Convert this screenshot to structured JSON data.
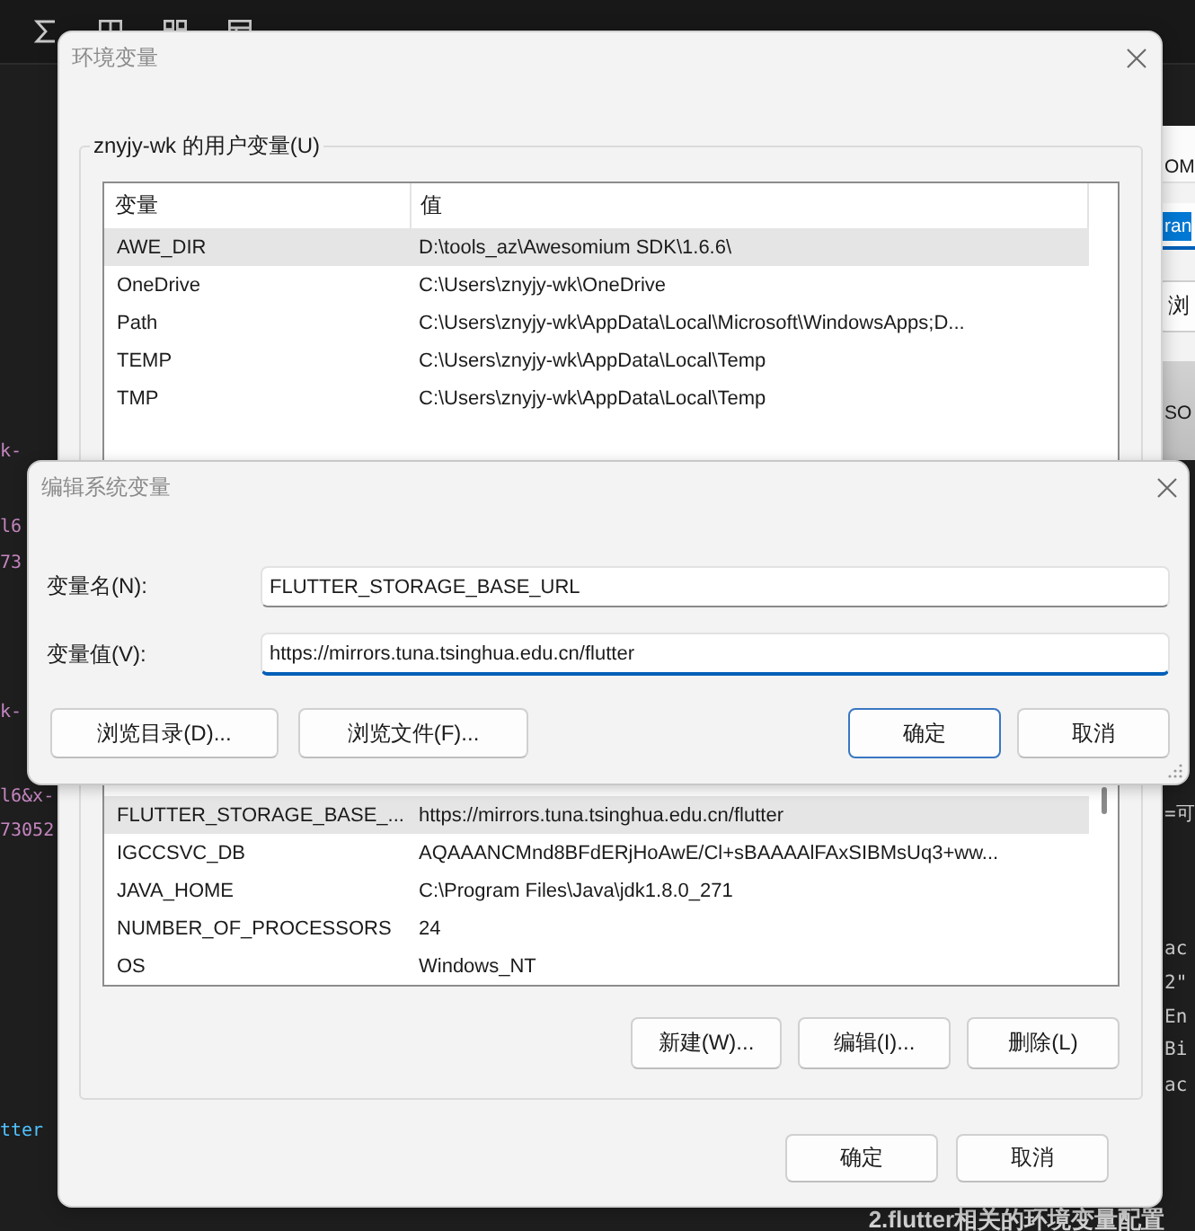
{
  "editor": {
    "left_fragments": [
      {
        "text": "k-",
        "kind": "string"
      },
      {
        "text": "l6",
        "kind": "string"
      },
      {
        "text": "73",
        "kind": "string"
      },
      {
        "text": "k-",
        "kind": "string"
      },
      {
        "text": "l6&x-",
        "kind": "string"
      },
      {
        "text": "73052",
        "kind": "string"
      },
      {
        "text": "tter",
        "kind": "name"
      }
    ],
    "right_fragments": [
      "=可",
      "ac",
      "2\"",
      "En",
      "Bi",
      "ac"
    ]
  },
  "background_window": {
    "header_text": "OM",
    "selected_text": "ran",
    "button": "浏",
    "panel_text": "SO"
  },
  "env_dialog": {
    "title": "环境变量",
    "user_group": {
      "label": "znyjy-wk 的用户变量(U)",
      "columns": [
        "变量",
        "值"
      ],
      "rows": [
        {
          "name": "AWE_DIR",
          "value": "D:\\tools_az\\Awesomium SDK\\1.6.6\\",
          "selected": true
        },
        {
          "name": "OneDrive",
          "value": "C:\\Users\\znyjy-wk\\OneDrive",
          "selected": false
        },
        {
          "name": "Path",
          "value": "C:\\Users\\znyjy-wk\\AppData\\Local\\Microsoft\\WindowsApps;D...",
          "selected": false
        },
        {
          "name": "TEMP",
          "value": "C:\\Users\\znyjy-wk\\AppData\\Local\\Temp",
          "selected": false
        },
        {
          "name": "TMP",
          "value": "C:\\Users\\znyjy-wk\\AppData\\Local\\Temp",
          "selected": false
        }
      ]
    },
    "system_group": {
      "rows": [
        {
          "name": "FLUTTER_STORAGE_BASE_...",
          "value": "https://mirrors.tuna.tsinghua.edu.cn/flutter",
          "selected": true
        },
        {
          "name": "IGCCSVC_DB",
          "value": "AQAAANCMnd8BFdERjHoAwE/Cl+sBAAAAlFAxSIBMsUq3+ww...",
          "selected": false
        },
        {
          "name": "JAVA_HOME",
          "value": "C:\\Program Files\\Java\\jdk1.8.0_271",
          "selected": false
        },
        {
          "name": "NUMBER_OF_PROCESSORS",
          "value": "24",
          "selected": false
        },
        {
          "name": "OS",
          "value": "Windows_NT",
          "selected": false
        }
      ],
      "buttons": [
        "新建(W)...",
        "编辑(I)...",
        "删除(L)"
      ]
    },
    "buttons": [
      "确定",
      "取消"
    ]
  },
  "edit_dialog": {
    "title": "编辑系统变量",
    "fields": [
      {
        "label": "变量名(N):",
        "value": "FLUTTER_STORAGE_BASE_URL",
        "focused": false
      },
      {
        "label": "变量值(V):",
        "value": "https://mirrors.tuna.tsinghua.edu.cn/flutter",
        "focused": true
      }
    ],
    "browse_buttons": [
      "浏览目录(D)...",
      "浏览文件(F)..."
    ],
    "buttons": [
      {
        "label": "确定",
        "default": true
      },
      {
        "label": "取消",
        "default": false
      }
    ]
  },
  "caption": "2.flutter相关的环境变量配置"
}
